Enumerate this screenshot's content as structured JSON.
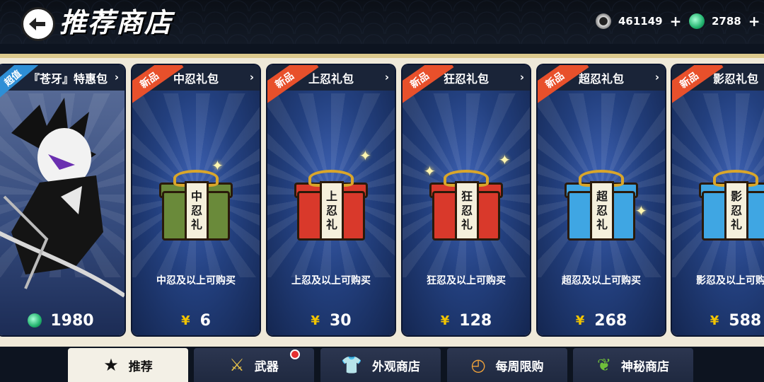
{
  "header": {
    "title": "推荐商店",
    "coins": "461149",
    "jade": "2788",
    "plus": "+"
  },
  "cards": [
    {
      "name": "『苍牙』特惠包",
      "tag": "超值",
      "desc": "",
      "price": "1980",
      "currency": "jade"
    },
    {
      "name": "中忍礼包",
      "tag": "新品",
      "box_text": [
        "中",
        "忍",
        "礼"
      ],
      "box_color": "#6a8a3a",
      "desc": "中忍及以上可购买",
      "price": "6",
      "currency": "yen"
    },
    {
      "name": "上忍礼包",
      "tag": "新品",
      "box_text": [
        "上",
        "忍",
        "礼"
      ],
      "box_color": "#d9392b",
      "desc": "上忍及以上可购买",
      "price": "30",
      "currency": "yen"
    },
    {
      "name": "狂忍礼包",
      "tag": "新品",
      "box_text": [
        "狂",
        "忍",
        "礼"
      ],
      "box_color": "#d9392b",
      "desc": "狂忍及以上可购买",
      "price": "128",
      "currency": "yen"
    },
    {
      "name": "超忍礼包",
      "tag": "新品",
      "box_text": [
        "超",
        "忍",
        "礼"
      ],
      "box_color": "#3fa6e3",
      "desc": "超忍及以上可购买",
      "price": "268",
      "currency": "yen"
    },
    {
      "name": "影忍礼包",
      "tag": "新品",
      "box_text": [
        "影",
        "忍",
        "礼"
      ],
      "box_color": "#3fa6e3",
      "desc": "影忍及以上可购买",
      "price": "588",
      "currency": "yen"
    }
  ],
  "yen_symbol": "¥",
  "tabs": [
    {
      "label": "推荐",
      "icon": "star-icon",
      "active": true
    },
    {
      "label": "武器",
      "icon": "sword-icon",
      "badge": true
    },
    {
      "label": "外观商店",
      "icon": "shirt-icon"
    },
    {
      "label": "每周限购",
      "icon": "clock-icon"
    },
    {
      "label": "神秘商店",
      "icon": "leaf-icon"
    }
  ]
}
